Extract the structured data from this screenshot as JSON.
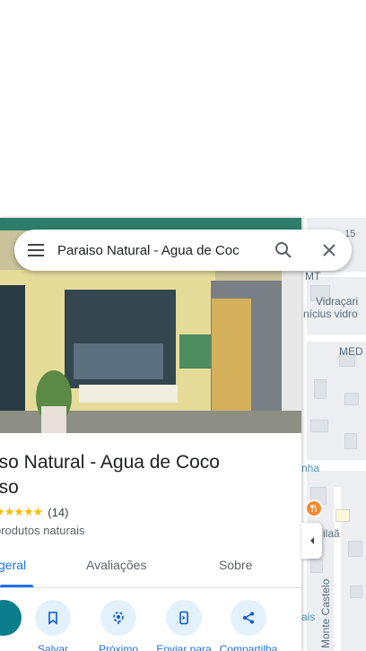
{
  "search": {
    "query": "Paraiso Natural - Agua de Coc"
  },
  "place": {
    "title_line1": "iso Natural - Agua de Coco",
    "title_line2": "iso",
    "rating_count": "(14)",
    "stars": "★★★★★",
    "category": "produtos naturais"
  },
  "tabs": [
    {
      "label": "geral"
    },
    {
      "label": "Avaliações"
    },
    {
      "label": "Sobre"
    }
  ],
  "actions": [
    {
      "label": "Salvar",
      "icon": "bookmark-icon"
    },
    {
      "label": "Próximo",
      "icon": "nearby-icon"
    },
    {
      "label": "Enviar para",
      "icon": "send-to-phone-icon"
    },
    {
      "label": "Compartilha",
      "icon": "share-icon"
    }
  ],
  "map": {
    "labels": [
      "MT",
      "Vidraçari",
      "nícius vidro",
      "MED",
      "nha",
      "ilaã",
      "ais",
      "Monte Castelo",
      "15"
    ]
  },
  "colors": {
    "accent": "#1a73e8",
    "action_bg": "#e3f1fb",
    "star": "#fbbc04",
    "food_pin": "#f28b30"
  }
}
